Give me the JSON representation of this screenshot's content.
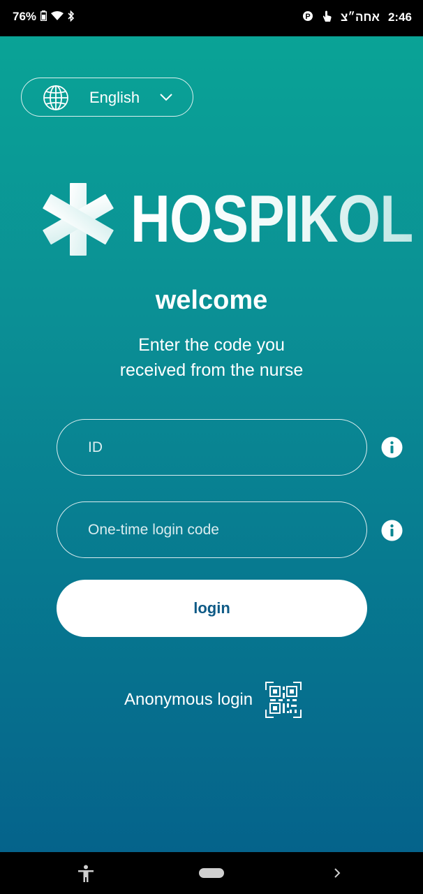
{
  "status_bar": {
    "battery_percent": "76%",
    "time": "2:46",
    "hebrew_label": "אחה״צ",
    "icons": [
      "battery-icon",
      "wifi-icon",
      "bluetooth-icon",
      "parking-icon",
      "touch-icon"
    ]
  },
  "language_selector": {
    "label": "English",
    "icon": "globe-icon"
  },
  "logo": {
    "text": "HOSPIKOL",
    "icon": "medical-star-icon"
  },
  "welcome": {
    "title": "welcome",
    "subtitle_line1": "Enter the code you",
    "subtitle_line2": "received from the nurse"
  },
  "form": {
    "id_placeholder": "ID",
    "id_value": "",
    "code_placeholder": "One-time login code",
    "code_value": "",
    "login_label": "login"
  },
  "anonymous_login": {
    "label": "Anonymous login",
    "icon": "qr-code-icon"
  },
  "nav_bar": {
    "icons": [
      "accessibility-icon",
      "home-pill",
      "forward-chevron-icon"
    ]
  },
  "colors": {
    "gradient_top": "#0aa396",
    "gradient_bottom": "#05638b",
    "button_text": "#0e5a86",
    "white": "#ffffff"
  }
}
